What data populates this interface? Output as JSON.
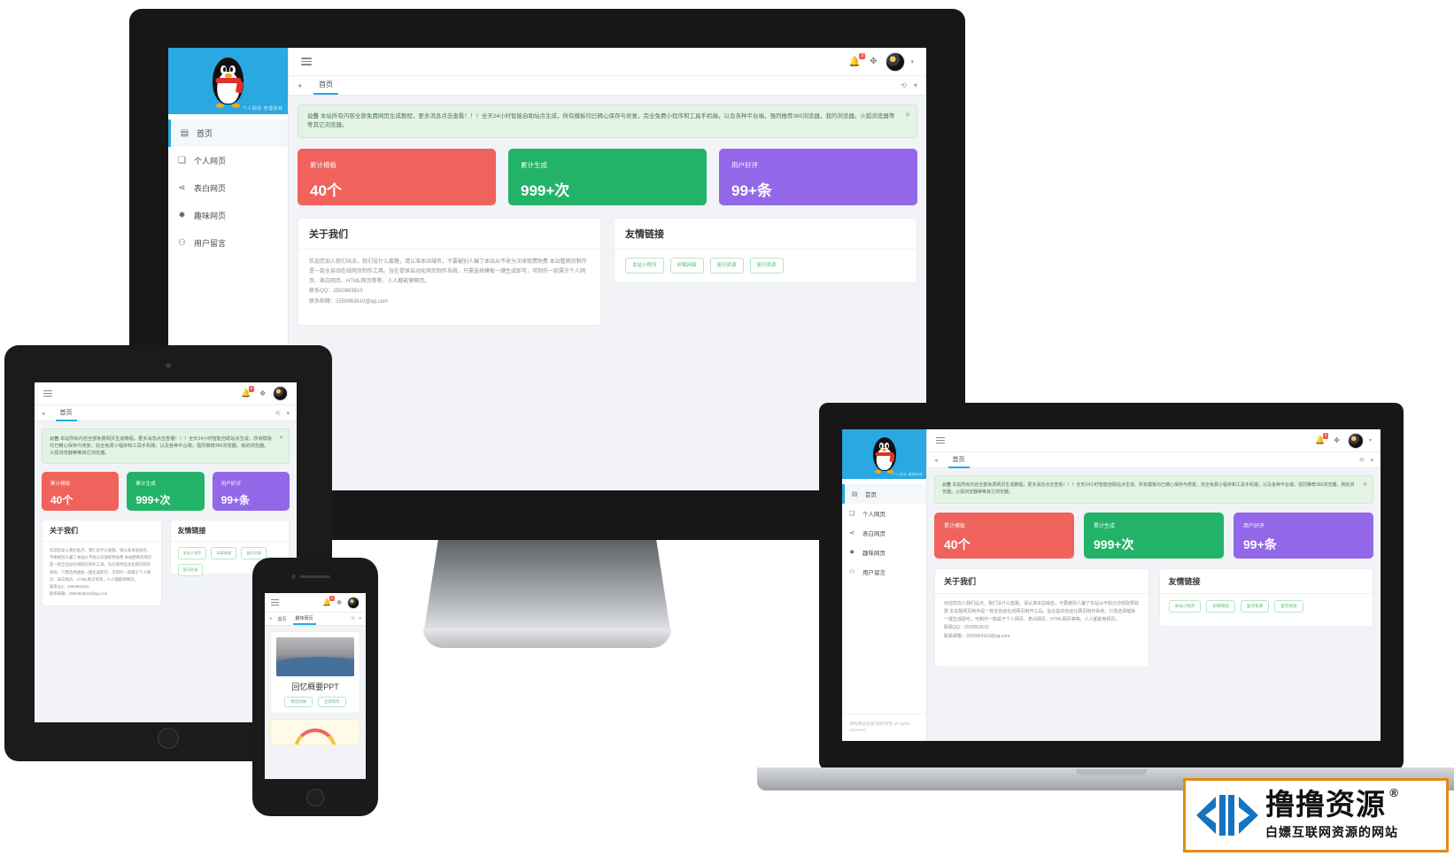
{
  "app": {
    "brand_name": "QQ",
    "logo_caption": "个人网站 管理系统",
    "topbar": {
      "menu_icon": "hamburger-icon",
      "bell_icon": "bell-icon",
      "bell_badge": "3",
      "settings_icon": "gear-icon",
      "avatar_icon": "user-avatar",
      "caret_icon": "chevron-down-icon"
    },
    "tabs": {
      "left_arrow": "chevron-left-icon",
      "items": [
        "首页"
      ],
      "active": "首页",
      "right_icons": [
        "refresh-icon",
        "chevron-down-icon"
      ]
    },
    "sidebar": {
      "items": [
        {
          "label": "首页",
          "icon": "dashboard-icon",
          "active": true
        },
        {
          "label": "个人网页",
          "icon": "page-icon",
          "active": false
        },
        {
          "label": "表白网页",
          "icon": "heart-share-icon",
          "active": false
        },
        {
          "label": "趣味网页",
          "icon": "star-icon",
          "active": false
        },
        {
          "label": "用户留言",
          "icon": "user-icon",
          "active": false
        }
      ],
      "footer": "源码网站系统 版权所有 all rights reserved."
    },
    "alert": {
      "prefix": "公告",
      "text": "本站所有内容全部免费网页生成教程，更多消息点击查看！！！全天24小时智能自助站点生成，所有模板均已精心保存与修复，完全免费小程序和工具手机端，以及各种平台端，强烈推荐360浏览器，我的浏览器。火狐浏览器等等其它浏览器。",
      "close_icon": "close-icon"
    },
    "stats": [
      {
        "label": "累计模板",
        "value": "40个",
        "color": "#f0635c"
      },
      {
        "label": "累计生成",
        "value": "999+次",
        "color": "#22b368"
      },
      {
        "label": "用户好评",
        "value": "99+条",
        "color": "#9268e8"
      }
    ],
    "about": {
      "title": "关于我们",
      "paragraphs": [
        "欢迎您加入我们站点，我们没什么套路，请认准本站域名，不要被别人骗了本站从不收分次收取赞助费 本站整网页制作是一款全自动在线网页制作工具。旨在提供自动化网页制作系统，只需选择模板一键生成即可，可制作一款属于个人网页、表白网页、HTML网页等等，人人都能够网页。",
        "联系QQ：2550863610",
        "联系邮箱：2550863610@qq.com"
      ]
    },
    "links": {
      "title": "友情链接",
      "items": [
        "本站小程序",
        "树莓网络",
        "复印资源",
        "复印资源"
      ]
    }
  },
  "phone": {
    "topbar": {
      "menu_icon": "hamburger-icon",
      "bell_icon": "bell-icon",
      "bell_badge": "3",
      "settings_icon": "gear-icon",
      "avatar_icon": "user-avatar"
    },
    "tabs": [
      "首页",
      "趣味网页"
    ],
    "card": {
      "title": "回忆概要PPT",
      "buttons": [
        "预览效果",
        "立即制作"
      ]
    }
  },
  "watermark": {
    "title": "撸撸资源",
    "registered": "®",
    "subtitle": "白嫖互联网资源的网站"
  },
  "colors": {
    "accent": "#29a8e1",
    "red": "#f0635c",
    "green": "#22b368",
    "purple": "#9268e8",
    "alert_bg": "#e3f3e4",
    "page_bg": "#f2f3f7"
  }
}
